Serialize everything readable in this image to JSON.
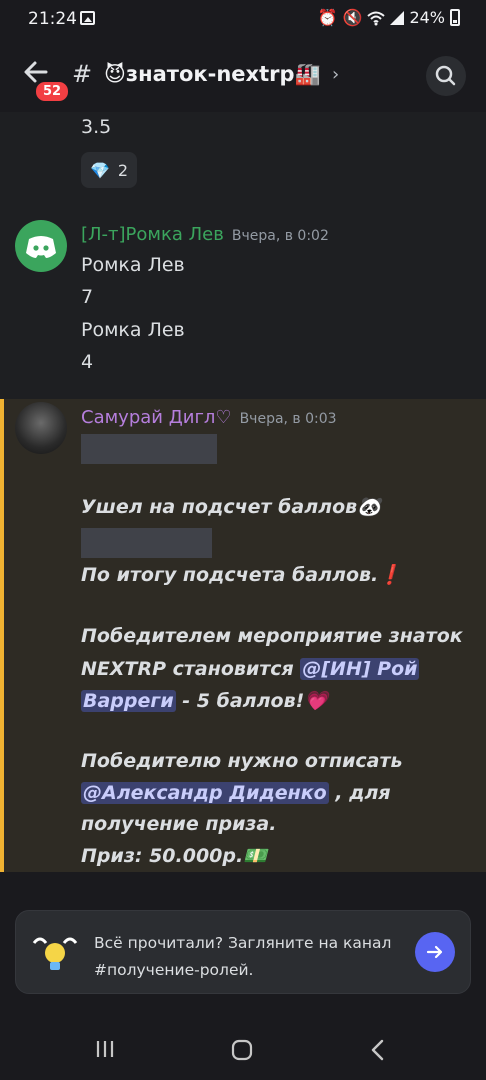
{
  "status_bar": {
    "time": "21:24",
    "battery": "24%"
  },
  "header": {
    "unread_count": "52",
    "channel_prefix": "#",
    "channel_name": "😈знаток-nextrp🏭"
  },
  "previous": {
    "text": "3.5",
    "reaction_emoji": "💎",
    "reaction_count": "2"
  },
  "messages": [
    {
      "author": "[Л-т]Ромка Лев",
      "author_color": "#3ba55d",
      "timestamp": "Вчера, в 0:02",
      "lines": [
        "Ромка Лев",
        "7",
        "Ромка Лев",
        "4"
      ]
    },
    {
      "author": "Самурай Дигл♡",
      "author_color": "#b57edc",
      "timestamp": "Вчера, в 0:03",
      "line1": "Ушел на подсчет баллов🐼",
      "line2": "По итогу подсчета баллов.❗",
      "line3a": "Победителем мероприятие знаток",
      "line3b": "NEXTRP становится ",
      "mention1a": "@[ИН] Рой",
      "mention1b": "Варреги",
      "line3c": " - 5 баллов!💗",
      "line4a": "Победителю нужно отписать",
      "mention2": "@Александр Диденко",
      "line4b": " , для",
      "line4c": "получение приза.",
      "line5": "Приз: 50.000р.💵"
    }
  ],
  "banner": {
    "text": "Всё прочитали? Загляните на канал #получение-ролей."
  },
  "colors": {
    "accent": "#5865f2",
    "highlight_bar": "#f0b232",
    "badge": "#f23f43"
  }
}
